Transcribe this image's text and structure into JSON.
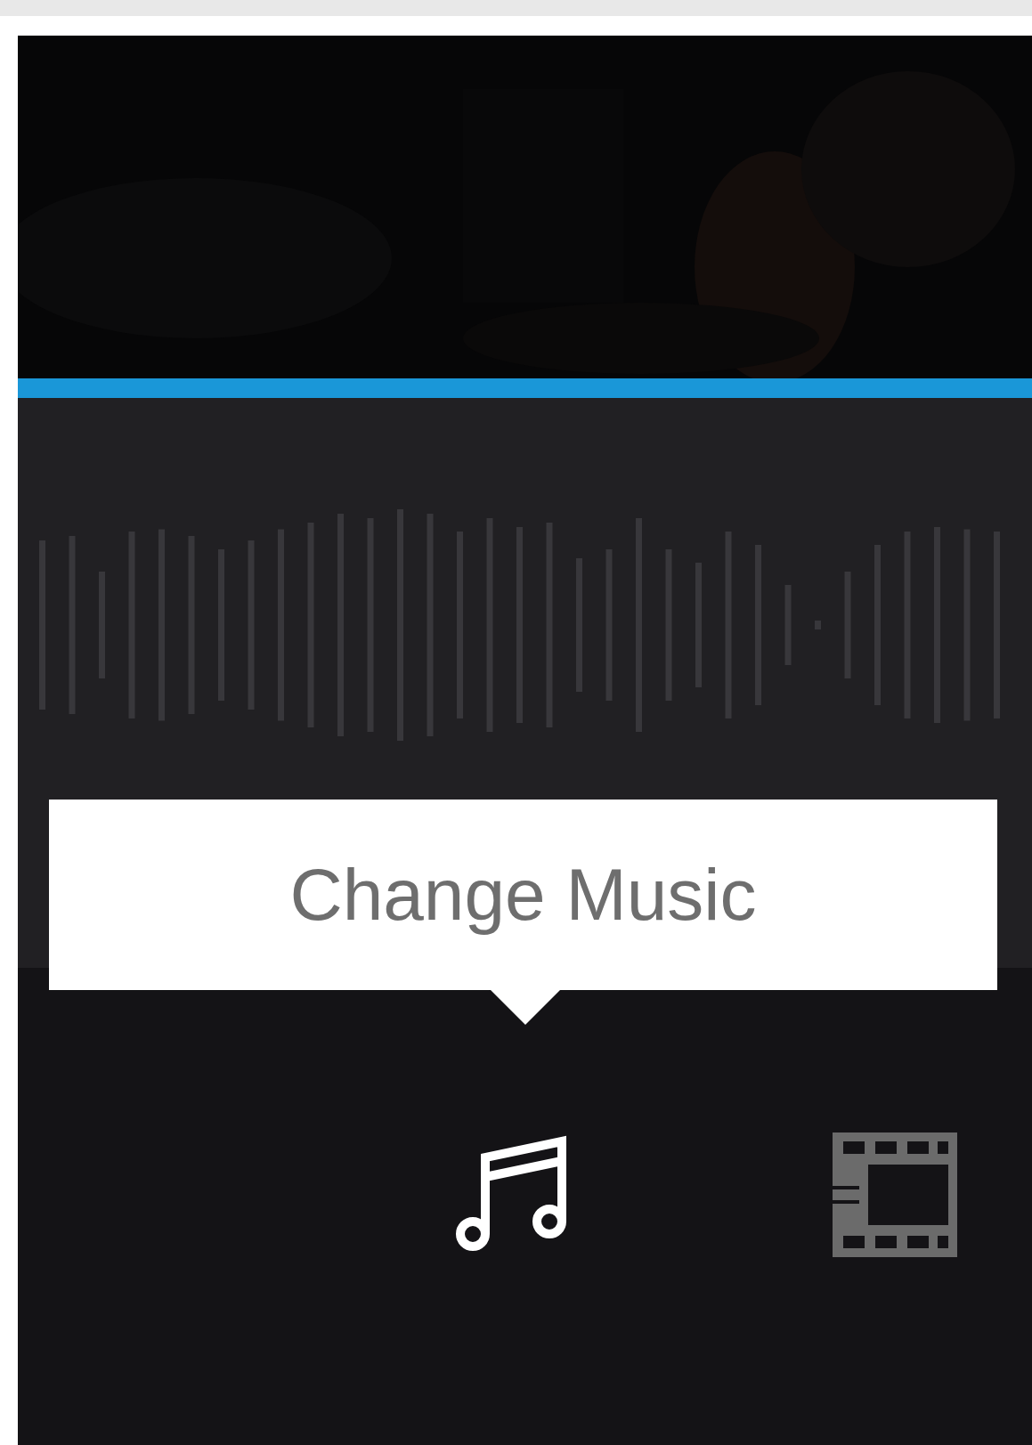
{
  "tooltip": {
    "text": "Change Music"
  },
  "tools": [
    {
      "kind": "music",
      "selected": true
    },
    {
      "kind": "film",
      "selected": false
    }
  ]
}
